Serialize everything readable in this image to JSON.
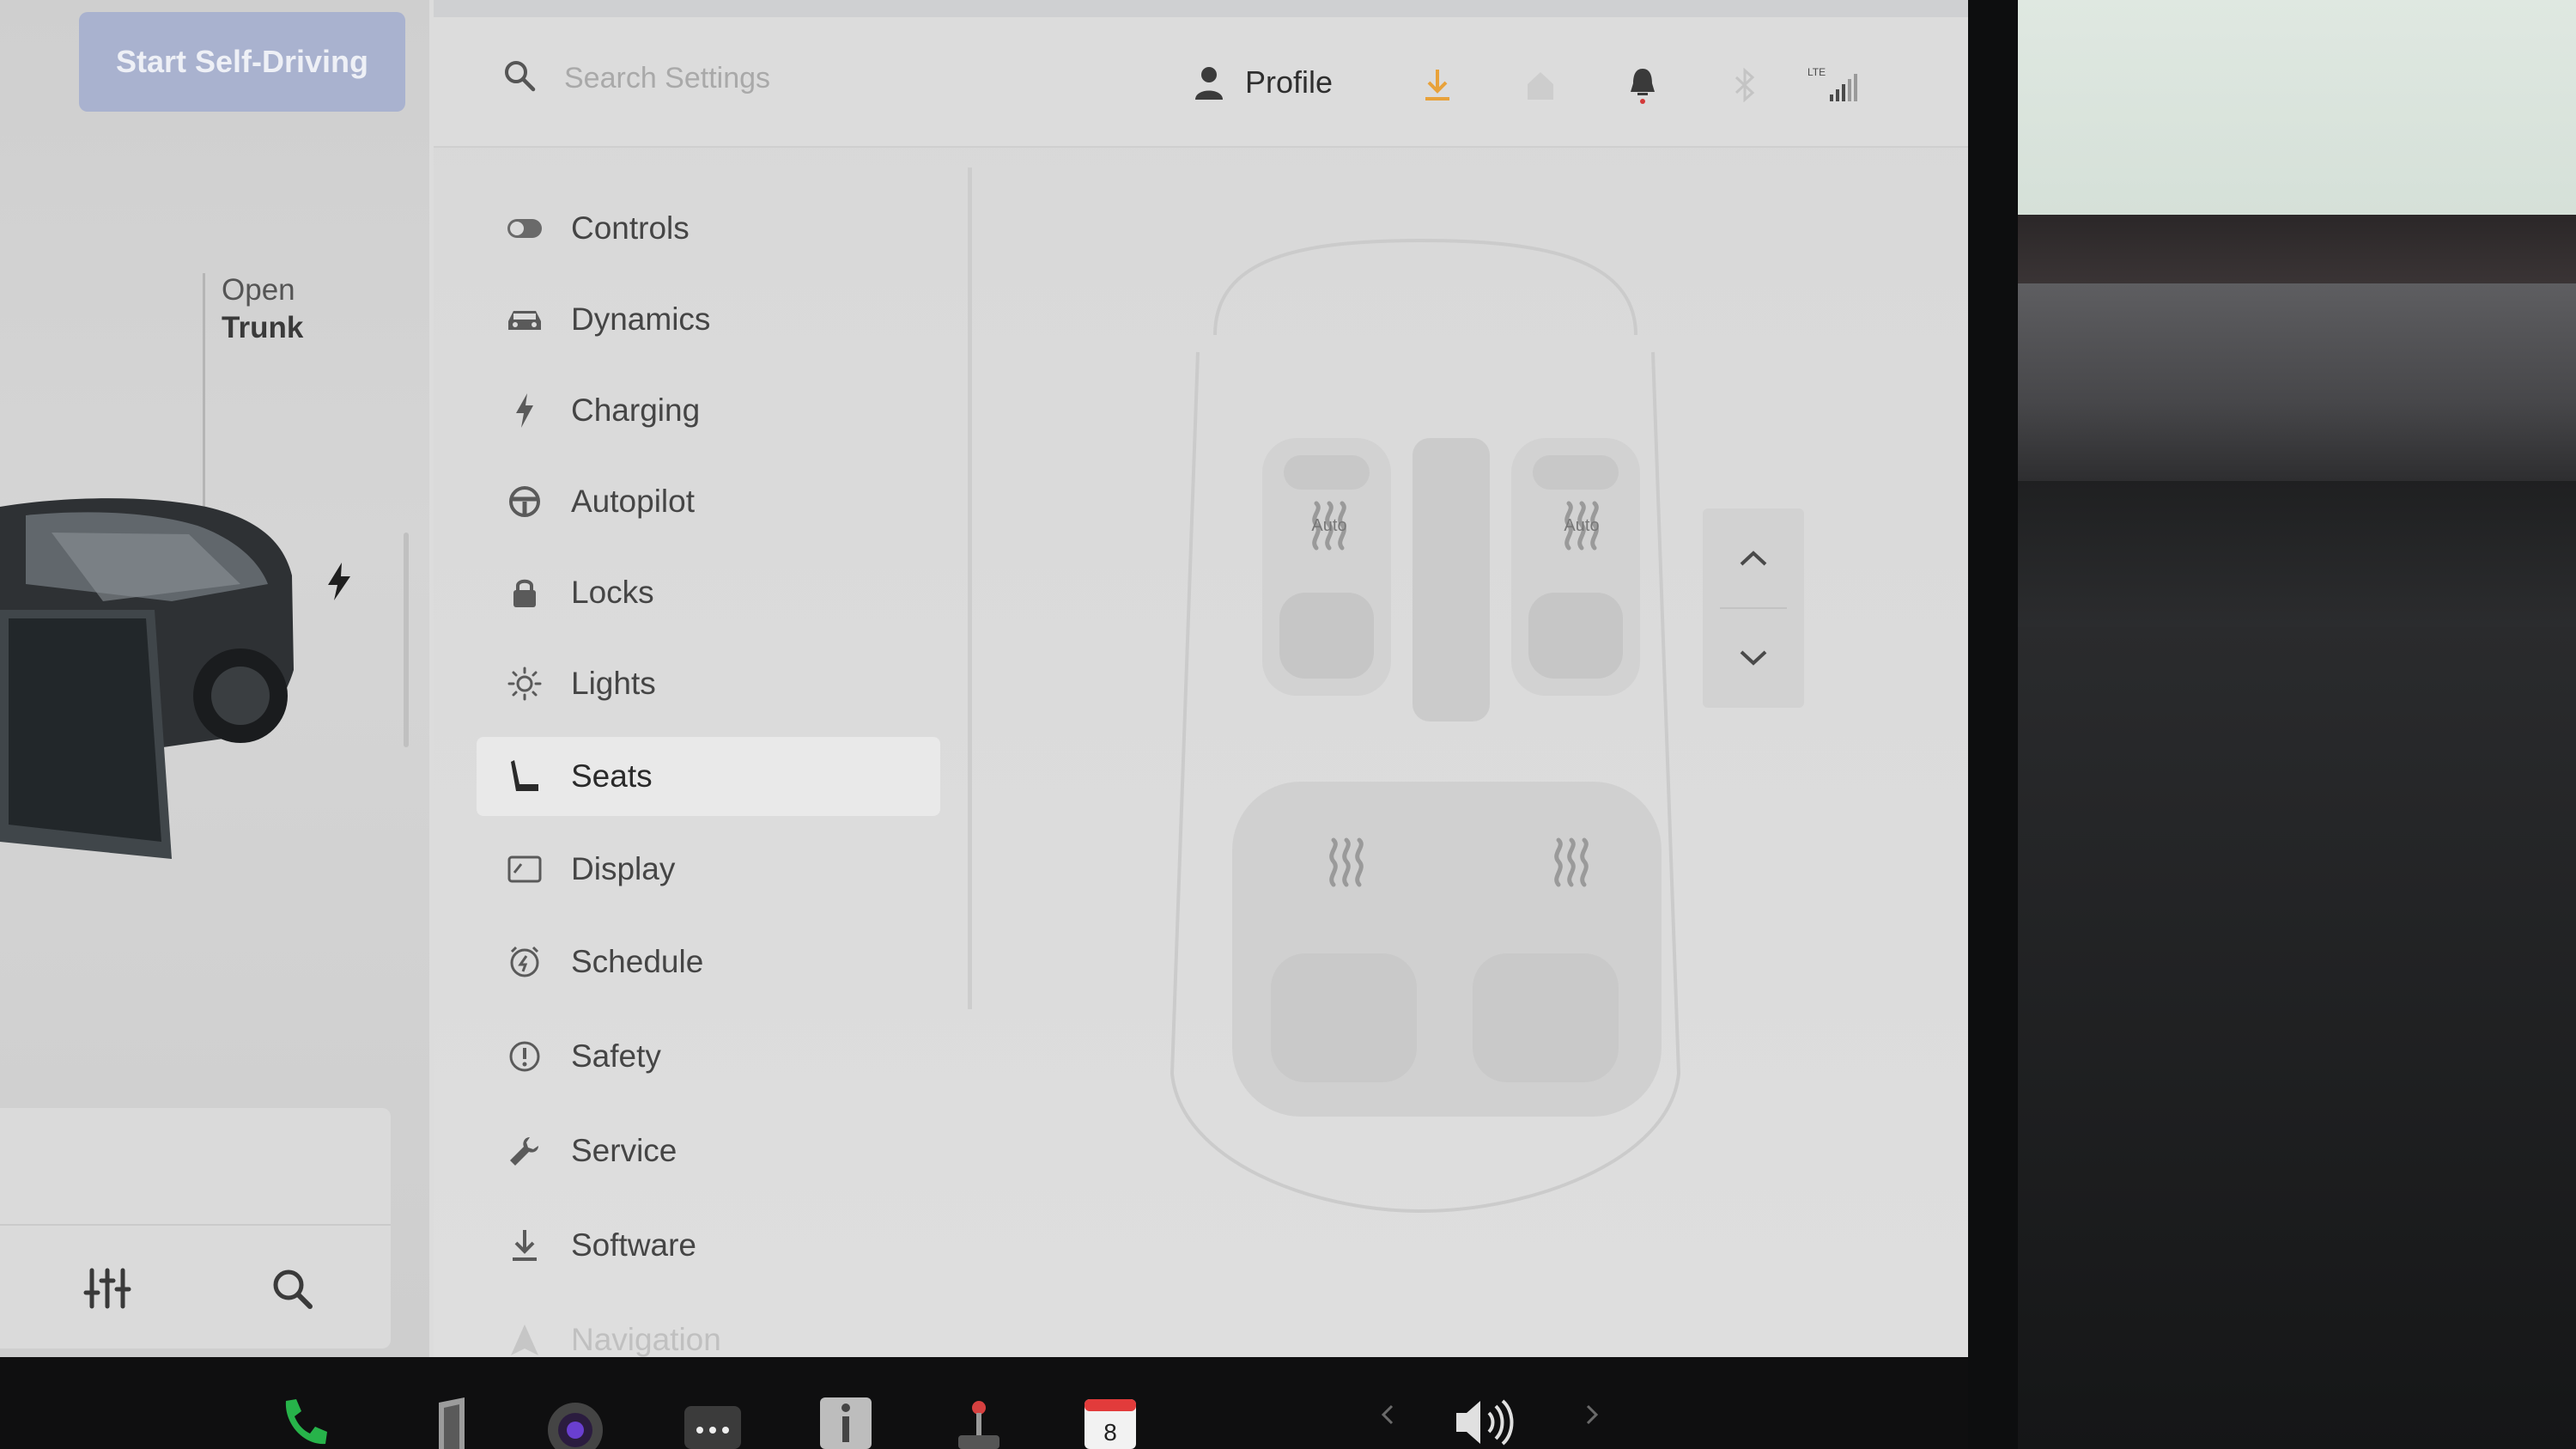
{
  "left_panel": {
    "self_driving_button": "Start Self-Driving",
    "trunk": {
      "action": "Open",
      "target": "Trunk"
    }
  },
  "topbar": {
    "search_placeholder": "Search Settings",
    "profile_label": "Profile",
    "status_icons": [
      "download-icon",
      "homelink-icon",
      "bell-icon",
      "bluetooth-icon",
      "lte-signal-icon"
    ],
    "lte_label": "LTE",
    "accent_color": "#e8a23a",
    "notification_dot_color": "#d33a3a"
  },
  "settings_menu": [
    {
      "label": "Controls",
      "icon": "toggle-icon",
      "active": false
    },
    {
      "label": "Dynamics",
      "icon": "car-icon",
      "active": false
    },
    {
      "label": "Charging",
      "icon": "bolt-icon",
      "active": false
    },
    {
      "label": "Autopilot",
      "icon": "steering-wheel-icon",
      "active": false
    },
    {
      "label": "Locks",
      "icon": "lock-icon",
      "active": false
    },
    {
      "label": "Lights",
      "icon": "sun-icon",
      "active": false
    },
    {
      "label": "Seats",
      "icon": "seat-icon",
      "active": true
    },
    {
      "label": "Display",
      "icon": "display-icon",
      "active": false
    },
    {
      "label": "Schedule",
      "icon": "clock-icon",
      "active": false
    },
    {
      "label": "Safety",
      "icon": "alert-icon",
      "active": false
    },
    {
      "label": "Service",
      "icon": "wrench-icon",
      "active": false
    },
    {
      "label": "Software",
      "icon": "download-icon",
      "active": false
    },
    {
      "label": "Navigation",
      "icon": "navigation-icon",
      "active": false
    }
  ],
  "seats": {
    "front_left_label": "Auto",
    "front_right_label": "Auto"
  },
  "dock": {
    "calendar_day": "8",
    "icons": [
      "phone-icon",
      "music-icon",
      "camera-icon",
      "more-icon",
      "info-icon",
      "toybox-icon",
      "calendar-icon",
      "prev-icon",
      "volume-icon",
      "next-icon"
    ]
  }
}
